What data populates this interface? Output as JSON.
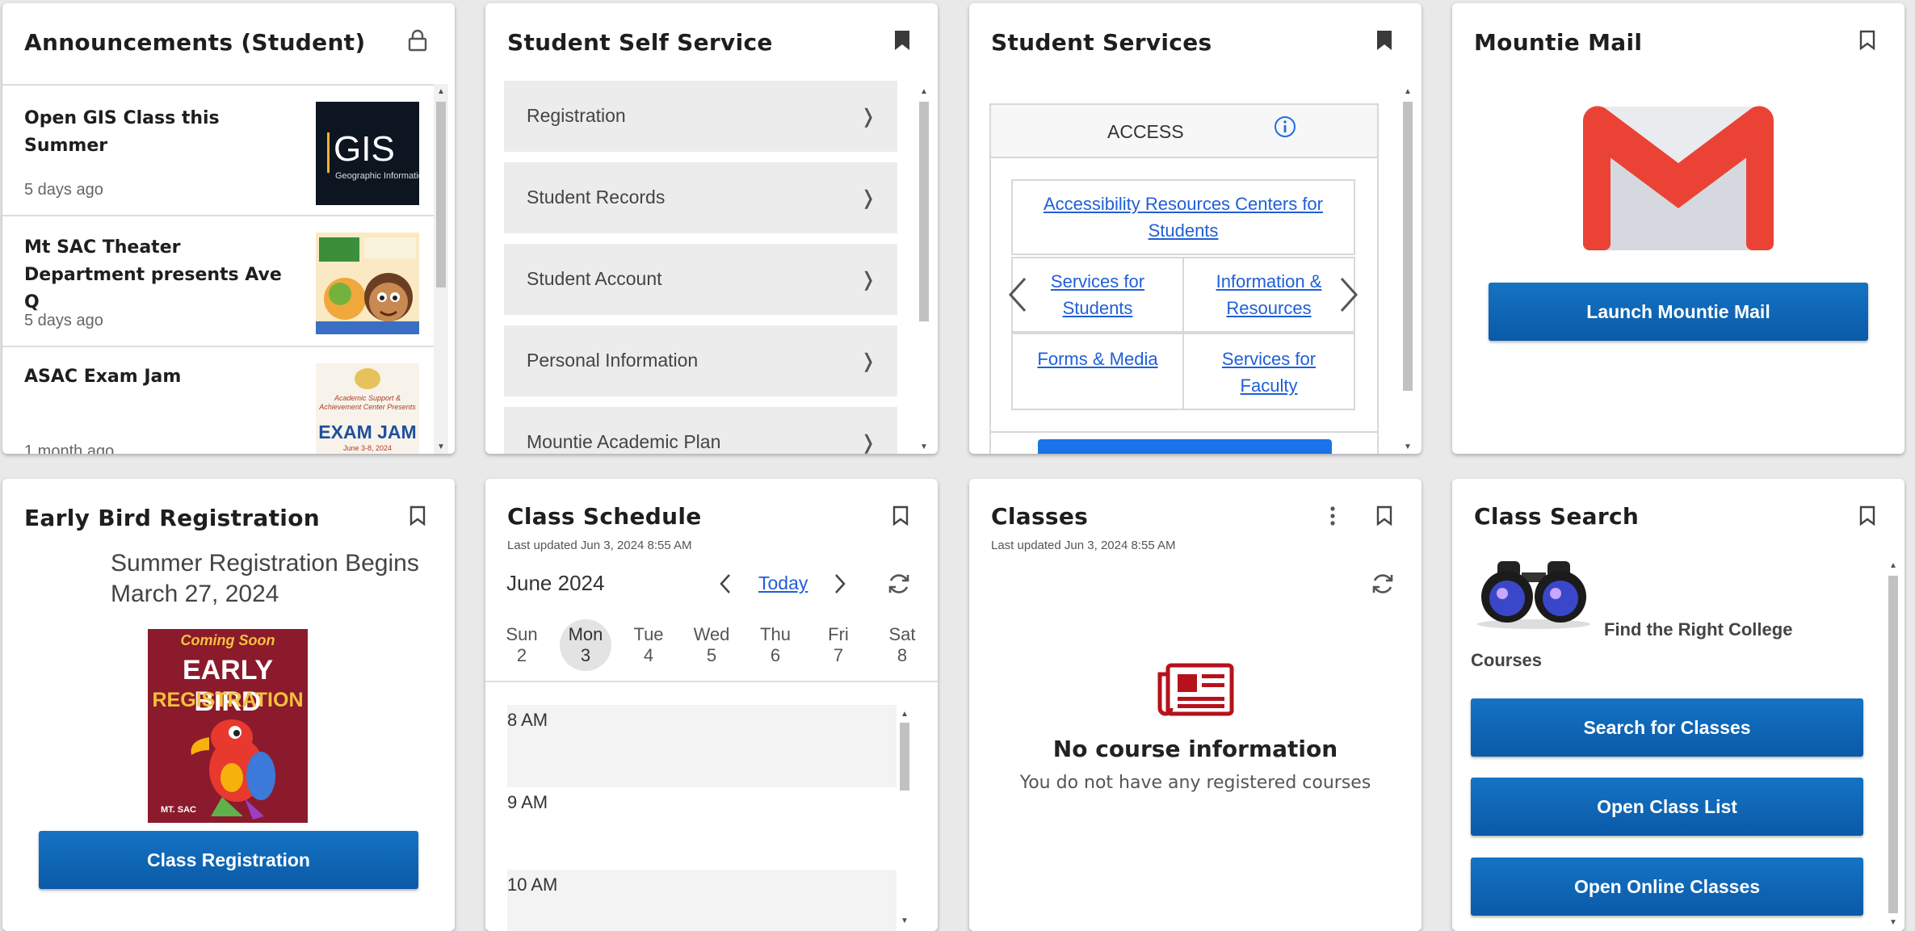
{
  "announcements": {
    "title": "Announcements (Student)",
    "items": [
      {
        "title": "Open GIS Class this Summer",
        "time": "5 days ago",
        "thumb_text": "GIS",
        "thumb_sub": "Geographic Information"
      },
      {
        "title": "Mt SAC Theater Department presents Ave Q",
        "time": "5 days ago"
      },
      {
        "title": "ASAC Exam Jam",
        "time": "1 month ago",
        "thumb_small": "Academic Support & Achievement Center Presents",
        "thumb_text": "EXAM JAM",
        "thumb_date": "June 3-8, 2024"
      }
    ]
  },
  "self_service": {
    "title": "Student Self Service",
    "items": [
      "Registration",
      "Student Records",
      "Student Account",
      "Personal Information",
      "Mountie Academic Plan"
    ],
    "chevron": "❭"
  },
  "student_services": {
    "title": "Student Services",
    "access_label": "ACCESS",
    "links": [
      "Accessibility Resources Centers for Students",
      "Services for Students",
      "Information & Resources",
      "Forms & Media",
      "Services for Faculty"
    ]
  },
  "mountie_mail": {
    "title": "Mountie Mail",
    "button": "Launch Mountie Mail"
  },
  "early_bird": {
    "title": "Early Bird Registration",
    "heading_line1": "Summer Registration Begins",
    "heading_line2": "March 27, 2024",
    "poster_top": "Coming Soon",
    "poster_line1": "EARLY BIRD",
    "poster_line2": "REGISTRATION",
    "poster_logo": "MT. SAC",
    "button": "Class Registration"
  },
  "class_schedule": {
    "title": "Class Schedule",
    "updated": "Last updated Jun 3, 2024 8:55 AM",
    "month": "June 2024",
    "today": "Today",
    "days": [
      {
        "name": "Sun",
        "num": "2"
      },
      {
        "name": "Mon",
        "num": "3"
      },
      {
        "name": "Tue",
        "num": "4"
      },
      {
        "name": "Wed",
        "num": "5"
      },
      {
        "name": "Thu",
        "num": "6"
      },
      {
        "name": "Fri",
        "num": "7"
      },
      {
        "name": "Sat",
        "num": "8"
      }
    ],
    "selected_day_index": 1,
    "hours": [
      "8 AM",
      "9 AM",
      "10 AM"
    ]
  },
  "classes": {
    "title": "Classes",
    "updated": "Last updated Jun 3, 2024 8:55 AM",
    "empty_title": "No course information",
    "empty_text": "You do not have any registered courses"
  },
  "class_search": {
    "title": "Class Search",
    "tagline_part1": "Find the Right College",
    "tagline_part2": "Courses",
    "buttons": [
      "Search for Classes",
      "Open Class List",
      "Open Online Classes"
    ]
  },
  "colors": {
    "button_blue": "#0a5aa7",
    "link_blue": "#1f5fd6",
    "gmail_red": "#ea4335",
    "classes_icon_red": "#b5121b",
    "poster_maroon": "#8b1a2c"
  }
}
